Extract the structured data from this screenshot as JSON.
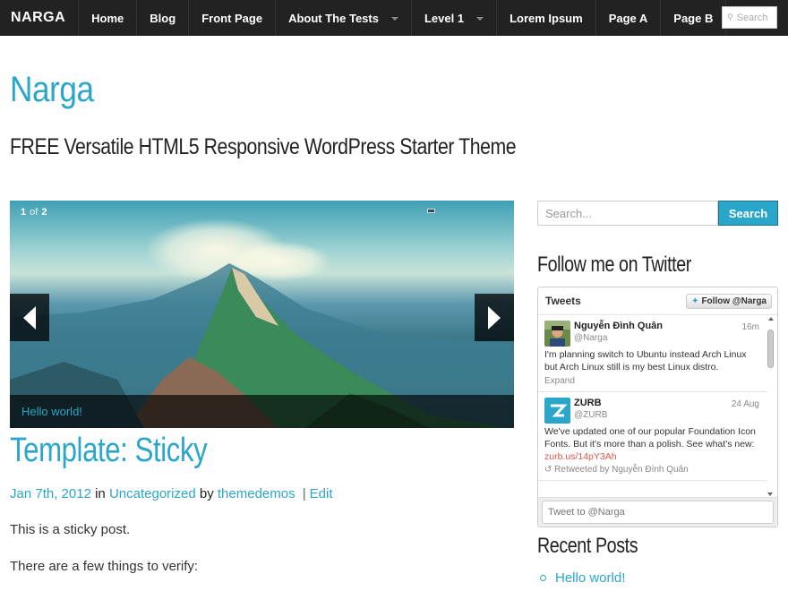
{
  "topbar": {
    "brand": "NARGA",
    "nav": [
      {
        "label": "Home",
        "dropdown": false
      },
      {
        "label": "Blog",
        "dropdown": false
      },
      {
        "label": "Front Page",
        "dropdown": false
      },
      {
        "label": "About The Tests",
        "dropdown": true
      },
      {
        "label": "Level 1",
        "dropdown": true
      },
      {
        "label": "Lorem Ipsum",
        "dropdown": false
      },
      {
        "label": "Page A",
        "dropdown": false
      },
      {
        "label": "Page B",
        "dropdown": false
      }
    ],
    "search_placeholder": "Search"
  },
  "header": {
    "title": "Narga",
    "description": "FREE Versatile HTML5 Responsive WordPress Starter Theme"
  },
  "slider": {
    "current": "1",
    "of": "of",
    "total": "2",
    "caption": "Hello world!"
  },
  "post": {
    "title": "Template: Sticky",
    "date": "Jan 7th, 2012",
    "in": "in",
    "category": "Uncategorized",
    "by": "by",
    "author": "themedemos",
    "sep": "|",
    "edit": "Edit",
    "p1": "This is a sticky post.",
    "p2": "There are a few things to verify:"
  },
  "sidebar": {
    "search_placeholder": "Search...",
    "search_button": "Search",
    "twitter_title": "Follow me on Twitter",
    "recent_title": "Recent Posts",
    "recent_posts": [
      "Hello world!"
    ]
  },
  "twitter": {
    "header": "Tweets",
    "follow_label": "Follow @Narga",
    "tweets": [
      {
        "name": "Nguyễn Đình Quân",
        "handle": "@Narga",
        "time": "16m",
        "text": "I'm planning switch to Ubuntu instead Arch Linux but Arch Linux still is my best Linux distro.",
        "expand": "Expand"
      },
      {
        "name": "ZURB",
        "handle": "@ZURB",
        "time": "24 Aug",
        "text": "We've updated one of our popular Foundation Icon Fonts. But it's more than a polish. See what's new:",
        "link": "zurb.us/14pY3Ah",
        "retweet": "Retweeted by Nguyễn Đình Quân"
      }
    ],
    "tweet_to": "Tweet to @Narga"
  },
  "colors": {
    "accent": "#2ba6cb",
    "topbar": "#222222",
    "link_red": "#e0574a"
  }
}
